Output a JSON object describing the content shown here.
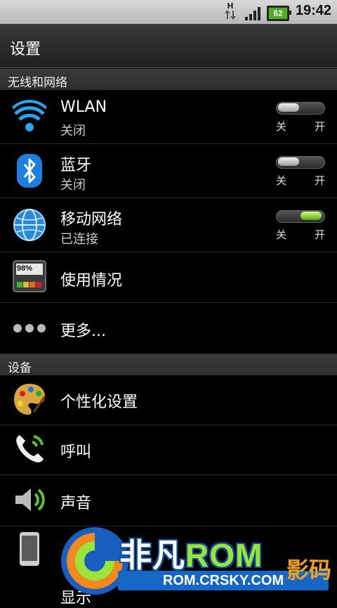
{
  "status": {
    "time": "19:42",
    "battery": "62",
    "network_type": "H"
  },
  "header": {
    "title": "设置"
  },
  "sections": [
    {
      "label": "无线和网络"
    },
    {
      "label": "设备"
    }
  ],
  "wireless": {
    "wlan": {
      "label": "WLAN",
      "status": "关闭",
      "toggle_off": "关",
      "toggle_on": "开",
      "enabled": false
    },
    "bluetooth": {
      "label": "蓝牙",
      "status": "关闭",
      "toggle_off": "关",
      "toggle_on": "开",
      "enabled": false
    },
    "mobile": {
      "label": "移动网络",
      "status": "已连接",
      "toggle_off": "关",
      "toggle_on": "开",
      "enabled": true
    },
    "usage": {
      "label": "使用情况",
      "meter": "98%"
    },
    "more": {
      "label": "更多..."
    }
  },
  "device": {
    "personalize": {
      "label": "个性化设置"
    },
    "call": {
      "label": "呼叫"
    },
    "sound": {
      "label": "声音"
    },
    "display": {
      "label": "显示"
    }
  },
  "watermark": {
    "brand_cn": "非凡",
    "brand_rom": "ROM",
    "url": "ROM.CRSKY.COM",
    "corner": "影码",
    "colors": {
      "blue": "#1566c5",
      "green": "#9be43a",
      "orange": "#f0a020"
    }
  },
  "colors": {
    "toggle_on": "#59a51b",
    "background": "#000000"
  }
}
